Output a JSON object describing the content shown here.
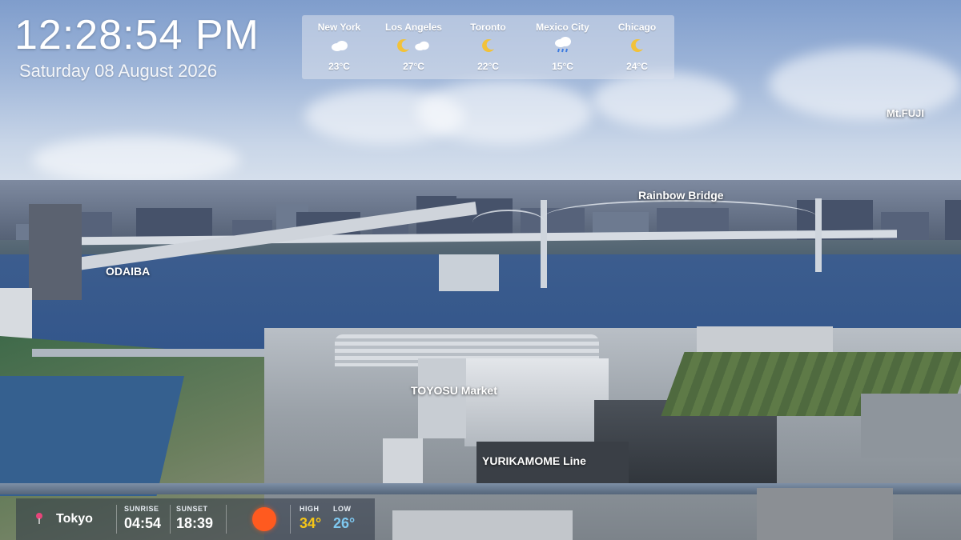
{
  "clock": {
    "time": "12:28:54 PM",
    "date": "Saturday 08 August 2026"
  },
  "weather": [
    {
      "city": "New York",
      "temp": "23°C",
      "icon": "cloud-icon"
    },
    {
      "city": "Los Angeles",
      "temp": "27°C",
      "icon": "moon-cloud-icon"
    },
    {
      "city": "Toronto",
      "temp": "22°C",
      "icon": "moon-icon"
    },
    {
      "city": "Mexico City",
      "temp": "15°C",
      "icon": "rain-cloud-icon"
    },
    {
      "city": "Chicago",
      "temp": "24°C",
      "icon": "moon-icon"
    }
  ],
  "labels": {
    "mtfuji": "Mt.FUJI",
    "rainbow": "Rainbow Bridge",
    "odaiba": "ODAIBA",
    "toyosu": "TOYOSU Market",
    "yurikamome": "YURIKAMOME Line"
  },
  "local": {
    "city": "Tokyo",
    "sunrise_label": "SUNRISE",
    "sunrise": "04:54",
    "sunset_label": "SUNSET",
    "sunset": "18:39",
    "high_label": "HIGH",
    "high": "34°",
    "low_label": "LOW",
    "low": "26°",
    "current_icon": "sun-icon"
  },
  "colors": {
    "high": "#f5c518",
    "low": "#7ec8f0",
    "sun": "#ff5a1f",
    "moon": "#f2c23a"
  }
}
